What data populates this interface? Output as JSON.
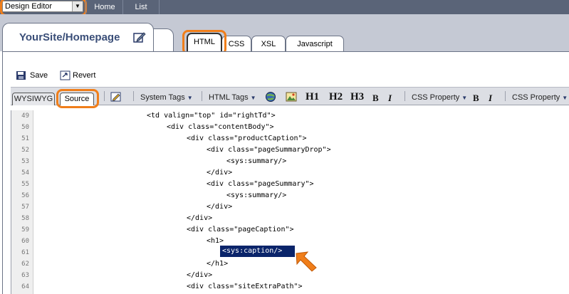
{
  "topbar": {
    "mode_select": "Design Editor",
    "nav": [
      "Home",
      "List"
    ]
  },
  "header": {
    "site_title": "YourSite/Homepage",
    "file_tabs": [
      "HTML",
      "CSS",
      "XSL",
      "Javascript"
    ],
    "active_tab": "HTML"
  },
  "actions": {
    "save": "Save",
    "revert": "Revert"
  },
  "toolbar": {
    "view_tabs": [
      "WYSIWYG",
      "Source"
    ],
    "active_view": "Source",
    "system_tags": "System Tags",
    "html_tags": "HTML Tags",
    "h1": "H1",
    "h2": "H2",
    "h3": "H3",
    "bold": "B",
    "italic": "I",
    "css_property_1": "CSS Property",
    "bold_2": "B",
    "italic_2": "I",
    "css_property_2": "CSS Property"
  },
  "editor": {
    "line_numbers": [
      "49",
      "50",
      "51",
      "52",
      "53",
      "54",
      "55",
      "56",
      "57",
      "58",
      "59",
      "60",
      "61",
      "62",
      "63",
      "64"
    ],
    "lines": [
      "<td valign=\"top\" id=\"rightTd\">",
      "<div class=\"contentBody\">",
      "<div class=\"productCaption\">",
      "<div class=\"pageSummaryDrop\">",
      "<sys:summary/>",
      "</div>",
      "<div class=\"pageSummary\">",
      "<sys:summary/>",
      "</div>",
      "</div>",
      "<div class=\"pageCaption\">",
      "<h1>",
      "<sys:caption/>",
      "</h1>",
      "</div>",
      "<div class=\"siteExtraPath\">"
    ],
    "selected_line": "61"
  },
  "colors": {
    "topbar": "#5a6478",
    "highlight_ring": "#f07e1a",
    "selection": "#0a246a",
    "title": "#3a4e78"
  },
  "icons": {
    "save": "save-disk-icon",
    "revert": "revert-icon",
    "edit": "pencil-edit-icon",
    "globe": "globe-link-icon",
    "image": "insert-image-icon",
    "pointer": "orange-arrow-icon"
  }
}
